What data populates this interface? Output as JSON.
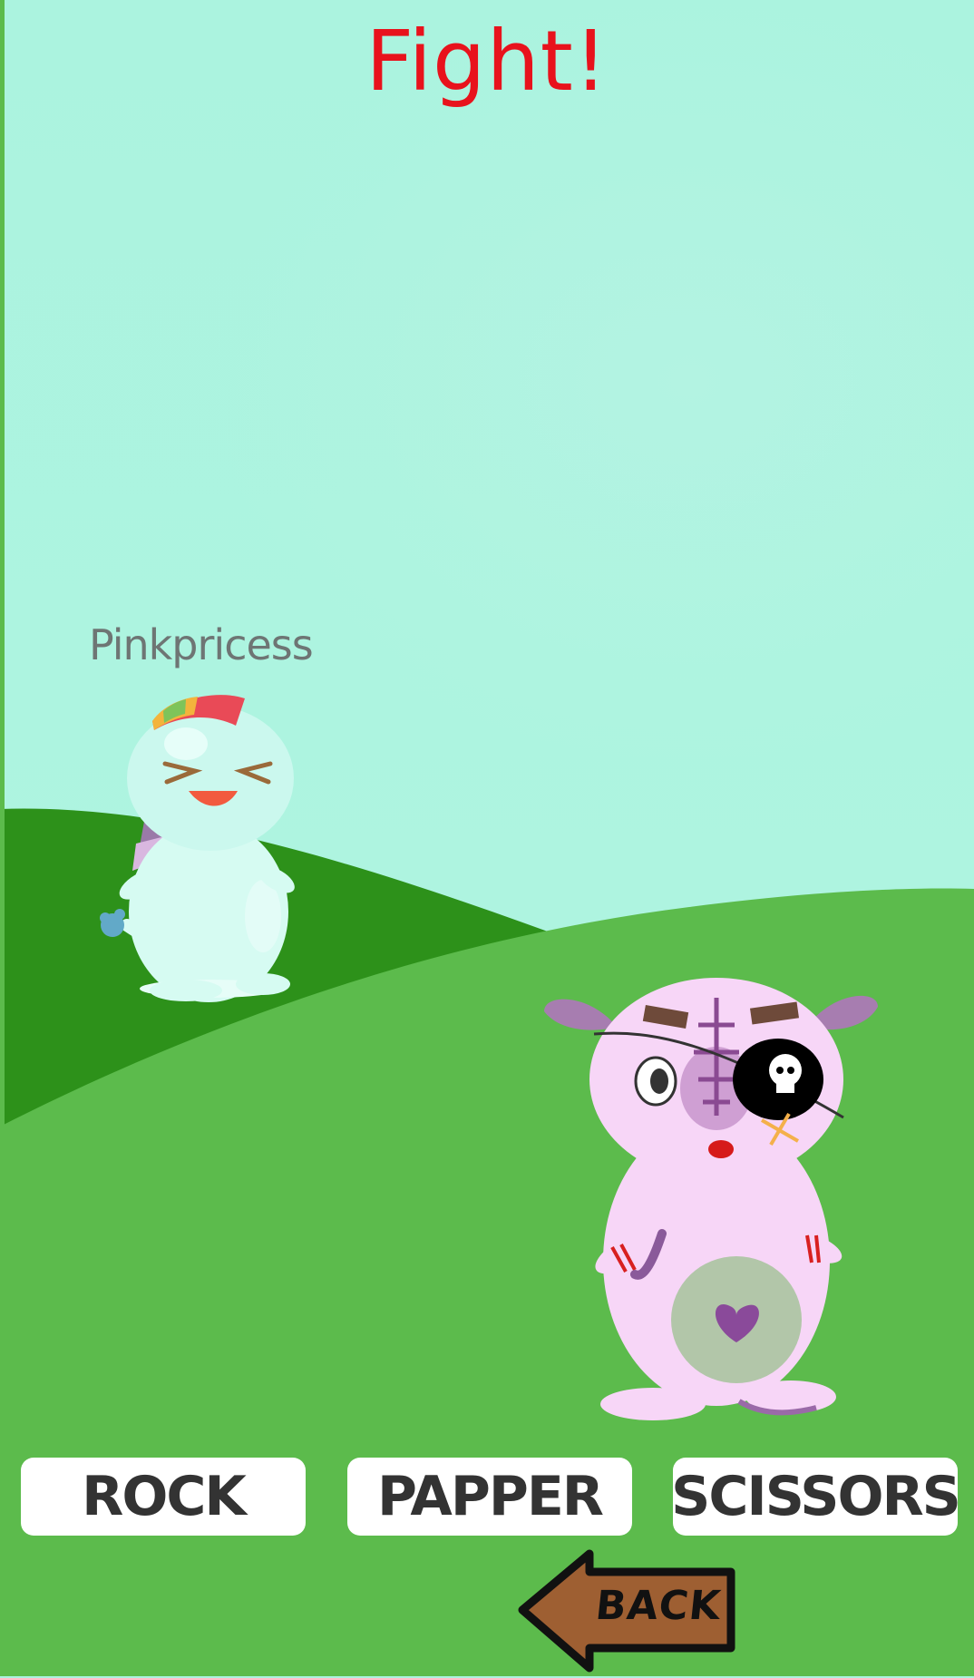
{
  "screen": {
    "title": "Fight!",
    "colors": {
      "title": "#e8121c",
      "sky": "#abf3df",
      "hill_dark": "#2d911a",
      "hill_light": "#5cbb4c"
    }
  },
  "player": {
    "name": "Pinkpricess",
    "character": "mint-dragon-rainbow-mane"
  },
  "opponent": {
    "character": "pink-pirate-bear-eyepatch"
  },
  "choices": {
    "rock": "ROCK",
    "paper": "PAPPER",
    "scissors": "SCISSORS"
  },
  "back": {
    "label": "BACK",
    "icon": "back-arrow-icon"
  }
}
